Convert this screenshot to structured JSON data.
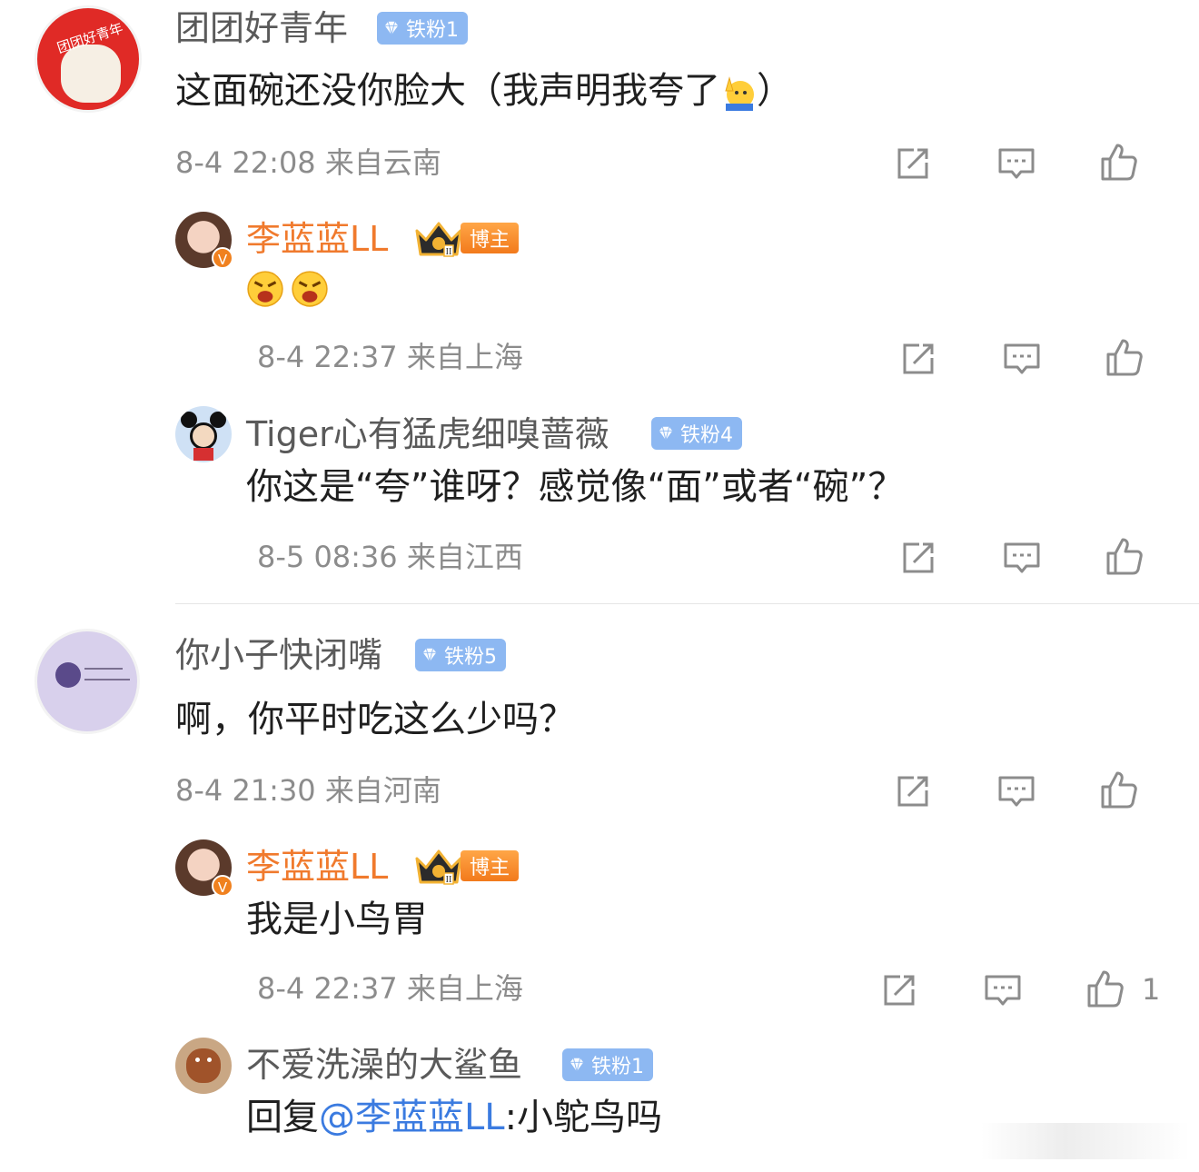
{
  "comments": [
    {
      "username": "团团好青年",
      "badge": "铁粉1",
      "avatar_text": "团团好青年",
      "text": "这面碗还没你脸大（我声明我夸了",
      "text_end": "）",
      "meta": "8-4 22:08 来自云南",
      "replies": [
        {
          "username": "李蓝蓝LL",
          "badge": "博主",
          "meta": "8-4 22:37 来自上海"
        },
        {
          "username": "Tiger心有猛虎细嗅蔷薇",
          "badge": "铁粉4",
          "text": "你这是“夸”谁呀？感觉像“面”或者“碗”？",
          "meta": "8-5 08:36 来自江西"
        }
      ]
    },
    {
      "username": "你小子快闭嘴",
      "badge": "铁粉5",
      "text": "啊，你平时吃这么少吗？",
      "meta": "8-4 21:30 来自河南",
      "replies": [
        {
          "username": "李蓝蓝LL",
          "badge": "博主",
          "text": "我是小鸟胃",
          "meta": "8-4 22:37 来自上海",
          "likes": "1"
        },
        {
          "username": "不爱洗澡的大鲨鱼",
          "badge": "铁粉1",
          "reply_prefix": "回复",
          "mention": "@李蓝蓝LL",
          "text": ":小鸵鸟吗"
        }
      ]
    }
  ],
  "icons": {
    "repost": "repost-icon",
    "comment": "comment-icon",
    "like": "thumbs-up-icon",
    "badge": "diamond-icon",
    "crown": "crown-icon"
  },
  "colors": {
    "blogger_name": "#f07a2d",
    "badge_bg": "#8db8f2",
    "mention": "#3b7be0",
    "meta": "#8c8c8c"
  }
}
